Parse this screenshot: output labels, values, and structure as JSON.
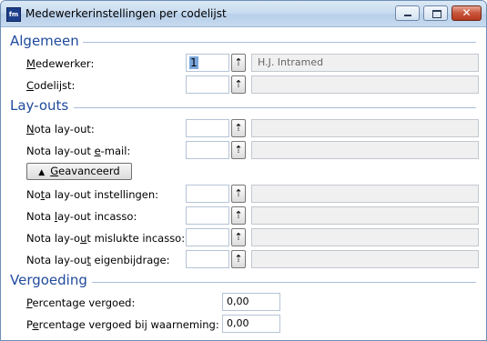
{
  "window": {
    "title": "Medewerkerinstellingen per codelijst",
    "close_glyph": "✕",
    "app_icon_text": "fm"
  },
  "sections": {
    "algemeen": "Algemeen",
    "layouts": "Lay-outs",
    "vergoeding": "Vergoeding"
  },
  "algemeen": {
    "medewerker": {
      "label_u": "M",
      "label_rest": "edewerker:",
      "code": "1",
      "description": "H.J. Intramed"
    },
    "codelijst": {
      "label_u": "C",
      "label_rest": "odelijst:",
      "code": "",
      "description": ""
    }
  },
  "layouts": {
    "nota": {
      "label_u": "N",
      "label_rest": "ota lay-out:"
    },
    "nota_email": {
      "label_pre": "Nota lay-out ",
      "label_u": "e",
      "label_rest": "-mail:"
    },
    "advanced_button": {
      "label_u": "G",
      "label_rest": "eavanceerd",
      "chevron": "▲"
    },
    "nota_instellingen": {
      "label_pre": "No",
      "label_u": "t",
      "label_rest": "a lay-out instellingen:"
    },
    "nota_incasso": {
      "label_pre": "Nota ",
      "label_u": "l",
      "label_rest": "ay-out incasso:"
    },
    "nota_mislukte": {
      "label_pre": "Nota lay-o",
      "label_u": "u",
      "label_rest": "t mislukte incasso:"
    },
    "nota_eigenbijdrage": {
      "label_pre": "Nota lay-ou",
      "label_u": "t",
      "label_rest": " eigenbijdrage:"
    }
  },
  "vergoeding": {
    "percentage": {
      "label_u": "P",
      "label_rest": "ercentage vergoed:",
      "value": "0,00"
    },
    "percentage_waarneming": {
      "label_pre": "P",
      "label_u": "e",
      "label_rest": "rcentage vergoed bij waarneming:",
      "value": "0,00"
    }
  },
  "lookup_glyph": "⇡"
}
